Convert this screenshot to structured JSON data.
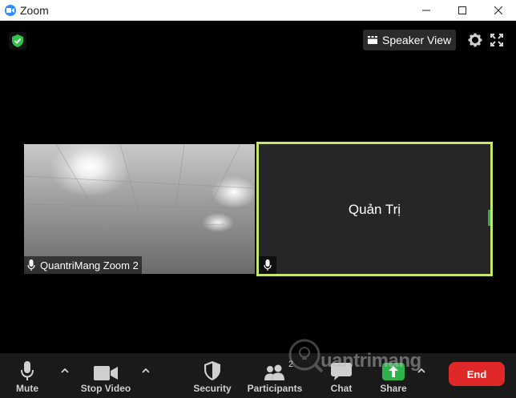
{
  "window": {
    "title": "Zoom",
    "controls": [
      "minimize-icon",
      "maximize-icon",
      "close-icon"
    ]
  },
  "top_bar": {
    "security_indicator": "shield-check-icon",
    "speaker_view_label": "Speaker View",
    "settings_icon": "gear-icon",
    "fullscreen_icon": "fullscreen-icon"
  },
  "participants": [
    {
      "name": "QuantriMang Zoom 2",
      "has_video": true,
      "mic_icon": "microphone-icon"
    },
    {
      "name": "Quản Trị",
      "has_video": false,
      "active_speaker": true,
      "mic_icon": "microphone-icon"
    }
  ],
  "toolbar": {
    "mute_label": "Mute",
    "stop_video_label": "Stop Video",
    "security_label": "Security",
    "participants_label": "Participants",
    "participants_count": "2",
    "chat_label": "Chat",
    "share_label": "Share",
    "end_label": "End"
  },
  "watermark": {
    "text": "uantrimang"
  },
  "colors": {
    "active_speaker_border": "#c5e86c",
    "end_button": "#e02828",
    "share_button": "#2db34a",
    "toolbar_bg": "#1a1a1a",
    "shield": "#35c14b"
  }
}
